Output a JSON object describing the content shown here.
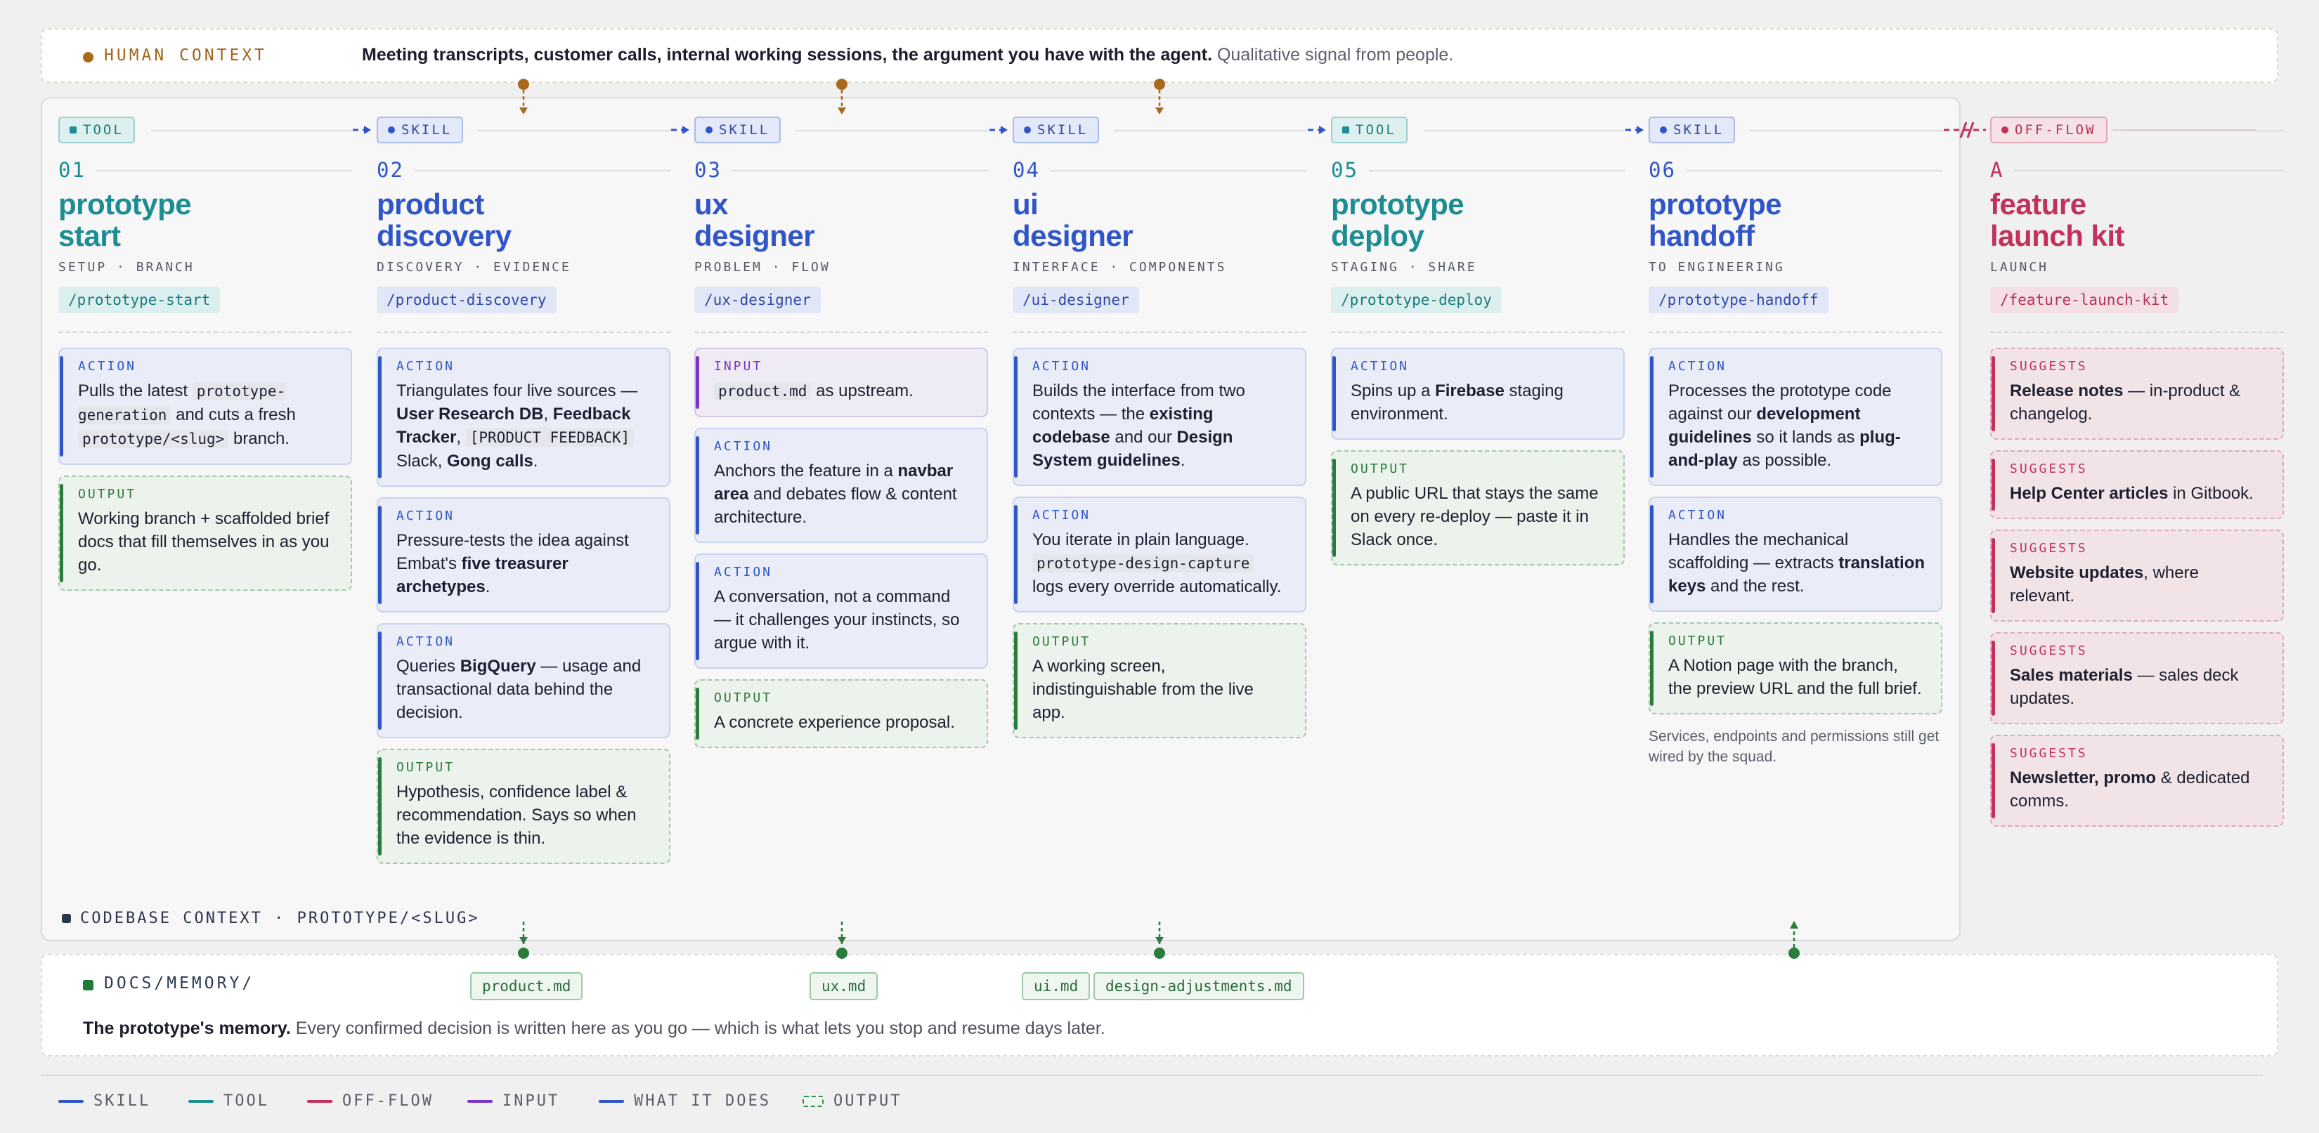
{
  "human": {
    "label": "HUMAN CONTEXT",
    "bold": "Meeting transcripts, customer calls, internal working sessions, the argument you have with the agent.",
    "muted": "Qualitative signal from people."
  },
  "codebase": "CODEBASE CONTEXT · PROTOTYPE/<SLUG>",
  "docs": {
    "label": "DOCS/MEMORY/",
    "bold": "The prototype's memory.",
    "text": "Every confirmed decision is written here as you go — which is what lets you stop and resume days later.",
    "chips": [
      "product.md",
      "ux.md",
      "ui.md",
      "design-adjustments.md"
    ]
  },
  "colors": {
    "skill": "#2f55c8",
    "tool": "#1c8d93",
    "offflow": "#c2315b",
    "input": "#7a34c6",
    "output": "#2a7b3c",
    "human": "#a8691a"
  },
  "legend": {
    "skill": "SKILL",
    "tool": "TOOL",
    "offflow": "OFF-FLOW",
    "input": "INPUT",
    "does": "WHAT IT DOES",
    "output": "OUTPUT"
  },
  "columns": [
    {
      "tag": "TOOL",
      "num": "01",
      "title1": "prototype",
      "title2": "start",
      "sub": "SETUP · BRANCH",
      "cmd": "/prototype-start",
      "cards": [
        {
          "kind": "ACTION",
          "html": "Pulls the latest <code>prototype-generation</code> and cuts a fresh <code>prototype/&lt;slug&gt;</code> branch."
        },
        {
          "kind": "OUTPUT",
          "html": "Working branch + scaffolded brief docs that fill themselves in as you go."
        }
      ]
    },
    {
      "tag": "SKILL",
      "num": "02",
      "title1": "product",
      "title2": "discovery",
      "sub": "DISCOVERY · EVIDENCE",
      "cmd": "/product-discovery",
      "cards": [
        {
          "kind": "ACTION",
          "html": "Triangulates four live sources — <b>User Research DB</b>, <b>Feedback Tracker</b>, <code>[PRODUCT FEEDBACK]</code> Slack, <b>Gong calls</b>."
        },
        {
          "kind": "ACTION",
          "html": "Pressure-tests the idea against Embat's <b>five treasurer archetypes</b>."
        },
        {
          "kind": "ACTION",
          "html": "Queries <b>BigQuery</b> — usage and transactional data behind the decision."
        },
        {
          "kind": "OUTPUT",
          "html": "Hypothesis, confidence label &amp; recommendation. Says so when the evidence is thin."
        }
      ]
    },
    {
      "tag": "SKILL",
      "num": "03",
      "title1": "ux",
      "title2": "designer",
      "sub": "PROBLEM · FLOW",
      "cmd": "/ux-designer",
      "cards": [
        {
          "kind": "INPUT",
          "html": "<code>product.md</code> as upstream."
        },
        {
          "kind": "ACTION",
          "html": "Anchors the feature in a <b>navbar area</b> and debates flow &amp; content architecture."
        },
        {
          "kind": "ACTION",
          "html": "A conversation, not a command — it challenges your instincts, so argue with it."
        },
        {
          "kind": "OUTPUT",
          "html": "A concrete experience proposal."
        }
      ]
    },
    {
      "tag": "SKILL",
      "num": "04",
      "title1": "ui",
      "title2": "designer",
      "sub": "INTERFACE · COMPONENTS",
      "cmd": "/ui-designer",
      "cards": [
        {
          "kind": "ACTION",
          "html": "Builds the interface from two contexts — the <b>existing codebase</b> and our <b>Design System guidelines</b>."
        },
        {
          "kind": "ACTION",
          "html": "You iterate in plain language. <code>prototype-design-capture</code> logs every override automatically."
        },
        {
          "kind": "OUTPUT",
          "html": "A working screen, indistinguishable from the live app."
        }
      ]
    },
    {
      "tag": "TOOL",
      "num": "05",
      "title1": "prototype",
      "title2": "deploy",
      "sub": "STAGING · SHARE",
      "cmd": "/prototype-deploy",
      "cards": [
        {
          "kind": "ACTION",
          "html": "Spins up a <b>Firebase</b> staging environment."
        },
        {
          "kind": "OUTPUT",
          "html": "A public URL that stays the same on every re-deploy — paste it in Slack once."
        }
      ]
    },
    {
      "tag": "SKILL",
      "num": "06",
      "title1": "prototype",
      "title2": "handoff",
      "sub": "TO ENGINEERING",
      "cmd": "/prototype-handoff",
      "cards": [
        {
          "kind": "ACTION",
          "html": "Processes the prototype code against our <b>development guidelines</b> so it lands as <b>plug-and-play</b> as possible."
        },
        {
          "kind": "ACTION",
          "html": "Handles the mechanical scaffolding — extracts <b>translation keys</b> and the rest."
        },
        {
          "kind": "OUTPUT",
          "html": "A Notion page with the branch, the preview URL and the full brief."
        }
      ],
      "note": "Services, endpoints and permissions still get wired by the squad."
    },
    {
      "tag": "OFF-FLOW",
      "num": "A",
      "title1": "feature",
      "title2": "launch kit",
      "sub": "LAUNCH",
      "cmd": "/feature-launch-kit",
      "cards": [
        {
          "kind": "SUGGESTS",
          "html": "<b>Release notes</b> — in-product &amp; changelog."
        },
        {
          "kind": "SUGGESTS",
          "html": "<b>Help Center articles</b> in Gitbook."
        },
        {
          "kind": "SUGGESTS",
          "html": "<b>Website updates</b>, where relevant."
        },
        {
          "kind": "SUGGESTS",
          "html": "<b>Sales materials</b> — sales deck updates."
        },
        {
          "kind": "SUGGESTS",
          "html": "<b>Newsletter, promo</b> &amp; dedicated comms."
        }
      ]
    }
  ]
}
